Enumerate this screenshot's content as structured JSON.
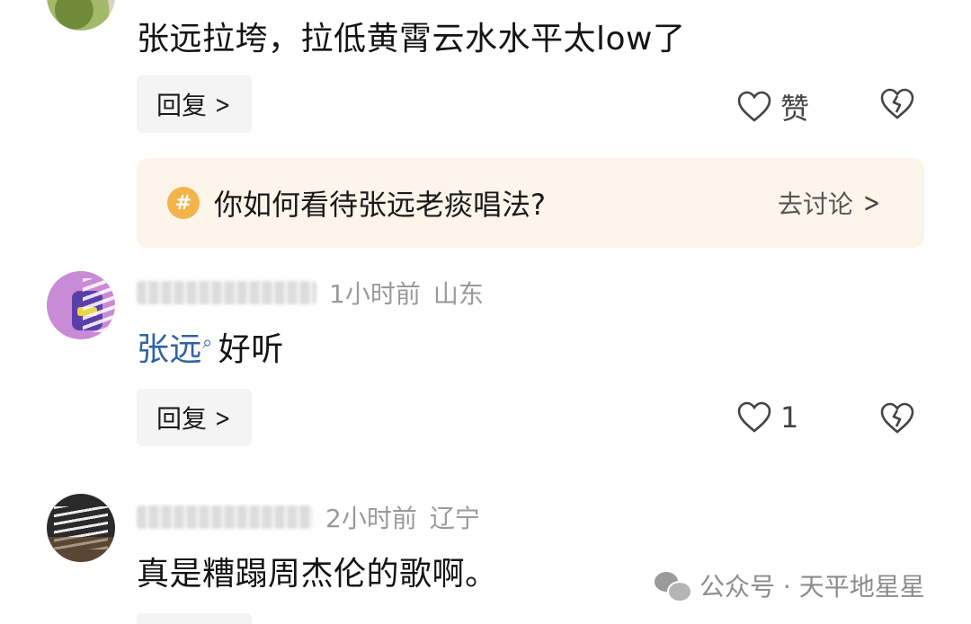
{
  "comments": [
    {
      "text": "张远拉垮，拉低黄霄云水水平太low了",
      "reply_label": "回复",
      "like_label": "赞"
    },
    {
      "time": "1小时前",
      "location": "山东",
      "mention": "张远",
      "text": "好听",
      "reply_label": "回复",
      "like_count": "1"
    },
    {
      "time": "2小时前",
      "location": "辽宁",
      "text": "真是糟蹋周杰伦的歌啊。"
    }
  ],
  "topic": {
    "icon": "#",
    "title": "你如何看待张远老痰唱法?",
    "link": "去讨论"
  },
  "watermark": {
    "text": "公众号 · 天平地星星"
  },
  "colors": {
    "mention": "#2f63a5",
    "topic_bg": "#fdf4ea",
    "topic_icon": "#f3b44a",
    "meta_gray": "#9a9a9a"
  }
}
